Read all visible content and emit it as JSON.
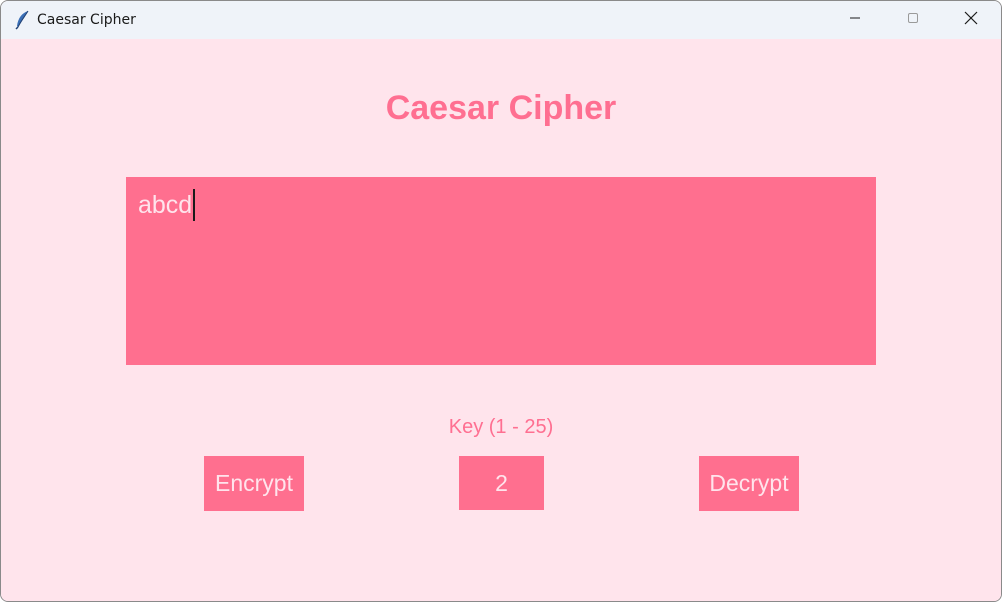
{
  "window": {
    "title": "Caesar Cipher",
    "app_icon": "feather-icon"
  },
  "titlebar_buttons": {
    "minimize_icon": "minimize-icon",
    "maximize_icon": "maximize-icon",
    "close_icon": "close-icon"
  },
  "main": {
    "heading": "Caesar Cipher",
    "text_value": "abcd",
    "key_label": "Key (1 - 25)",
    "key_value": "2",
    "encrypt_label": "Encrypt",
    "decrypt_label": "Decrypt"
  },
  "colors": {
    "background": "#ffe4ec",
    "accent": "#ff6f91",
    "field": "#ff6f8f",
    "field_text": "#ffe4ec"
  }
}
